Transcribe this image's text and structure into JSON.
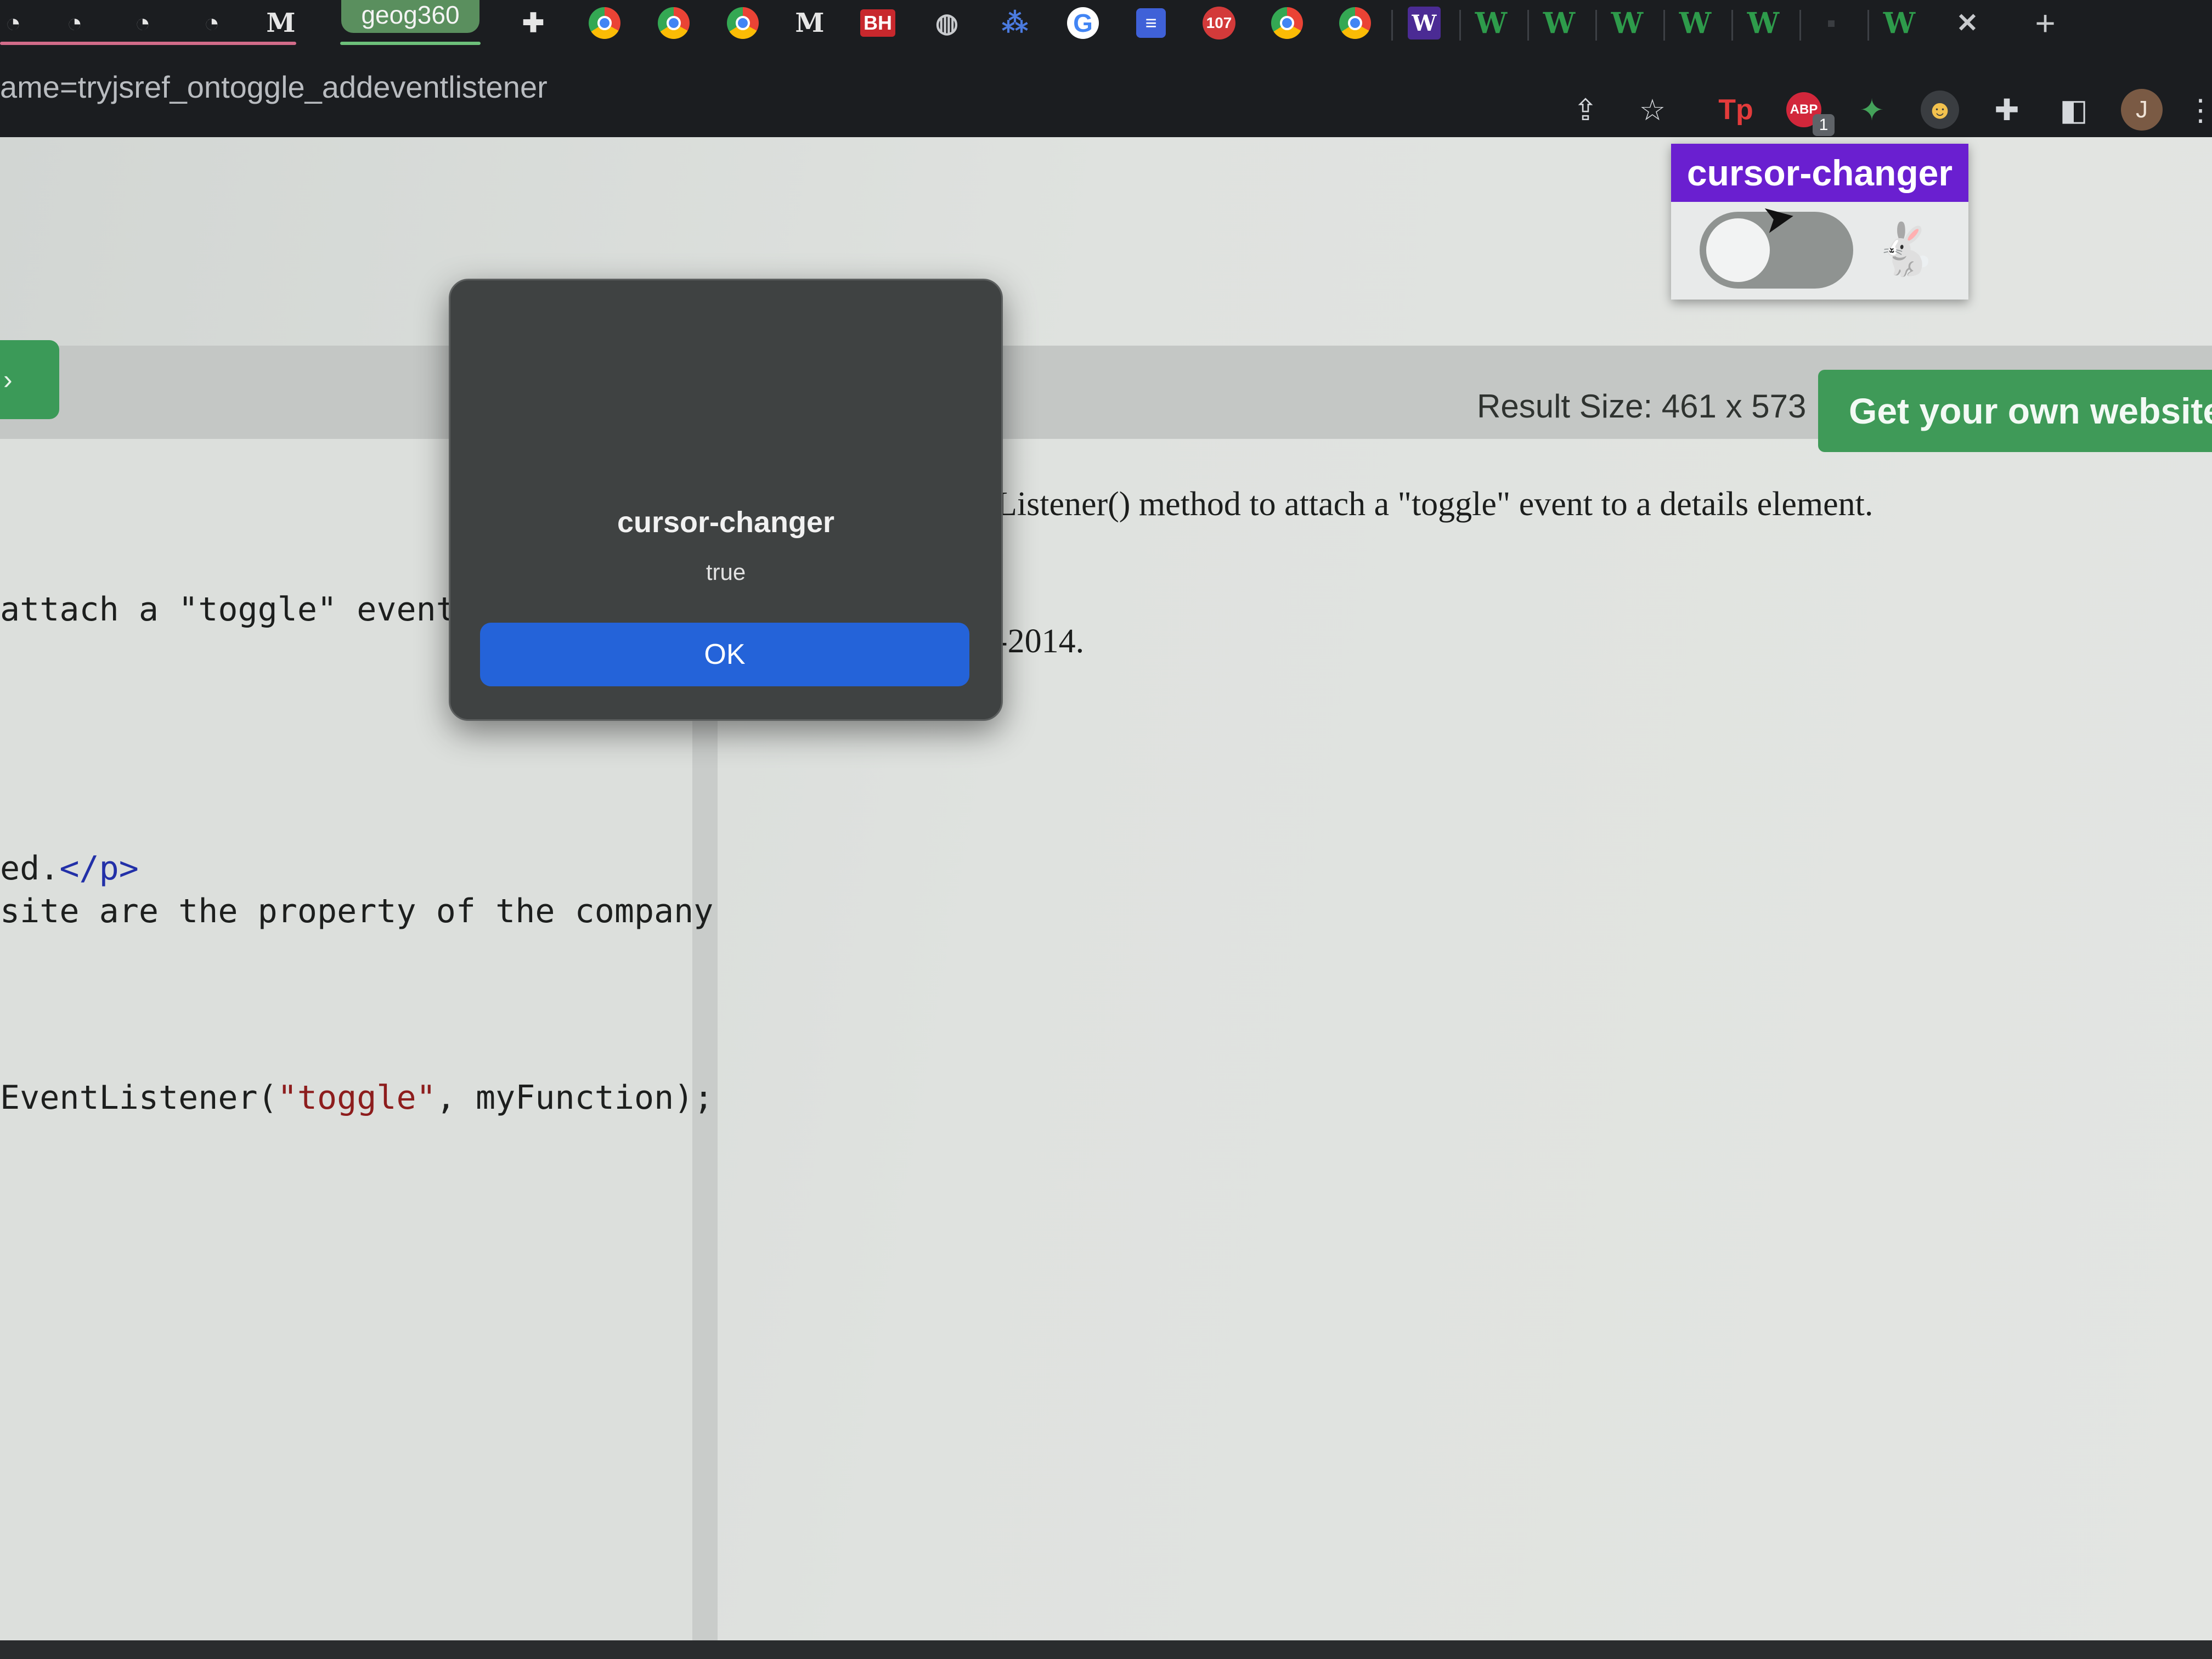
{
  "browser": {
    "active_tab_label": "geog360",
    "url_fragment": "ame=tryjsref_ontoggle_addeventlistener",
    "tab_icons": [
      "github-icon",
      "github-icon",
      "github-icon",
      "medium-icon",
      "puzzle-icon",
      "chrome-icon",
      "chrome-icon",
      "chrome-icon",
      "medium-icon",
      "bh-icon",
      "globe-icon",
      "zb-icon",
      "google-icon",
      "list-icon",
      "calendar-icon",
      "chrome-icon",
      "chrome-icon",
      "w-icon",
      "w3-icon",
      "w3-icon",
      "w3-icon",
      "w3-icon",
      "w3-icon",
      "w3-icon"
    ],
    "bh_label": "BH",
    "calendar_label": "107",
    "w_label": "W",
    "w3_label": "W",
    "close_tab_glyph": "✕",
    "new_tab_glyph": "+",
    "abp_label": "ABP",
    "abp_badge": "1",
    "tp_label": "Tp",
    "avatar_initial": "J"
  },
  "page": {
    "result_size": "Result Size: 461 x 573",
    "get_website_button": "Get your own website",
    "code_lines": {
      "line1_plain": "attach a \"toggle\" event",
      "line2_plain": "ed.",
      "line2_tag": "</p>",
      "line3_plain": "site are the property of the company",
      "line4_plain": "EventListener(",
      "line4_str": "\"toggle\"",
      "line4_rest": ", myFunction);"
    },
    "result_lines": {
      "line1": "Listener() method to attach a \"toggle\" event to a details element.",
      "line2": "-2014."
    }
  },
  "extension_popup": {
    "title": "cursor-changer",
    "toggle_on": false
  },
  "alert_dialog": {
    "title": "cursor-changer",
    "message": "true",
    "ok_label": "OK"
  },
  "colors": {
    "accent_green": "#3f9a58",
    "extension_purple": "#6a1fd0",
    "dialog_button_blue": "#2463d9",
    "tab_active_green": "#5a8f5e"
  }
}
